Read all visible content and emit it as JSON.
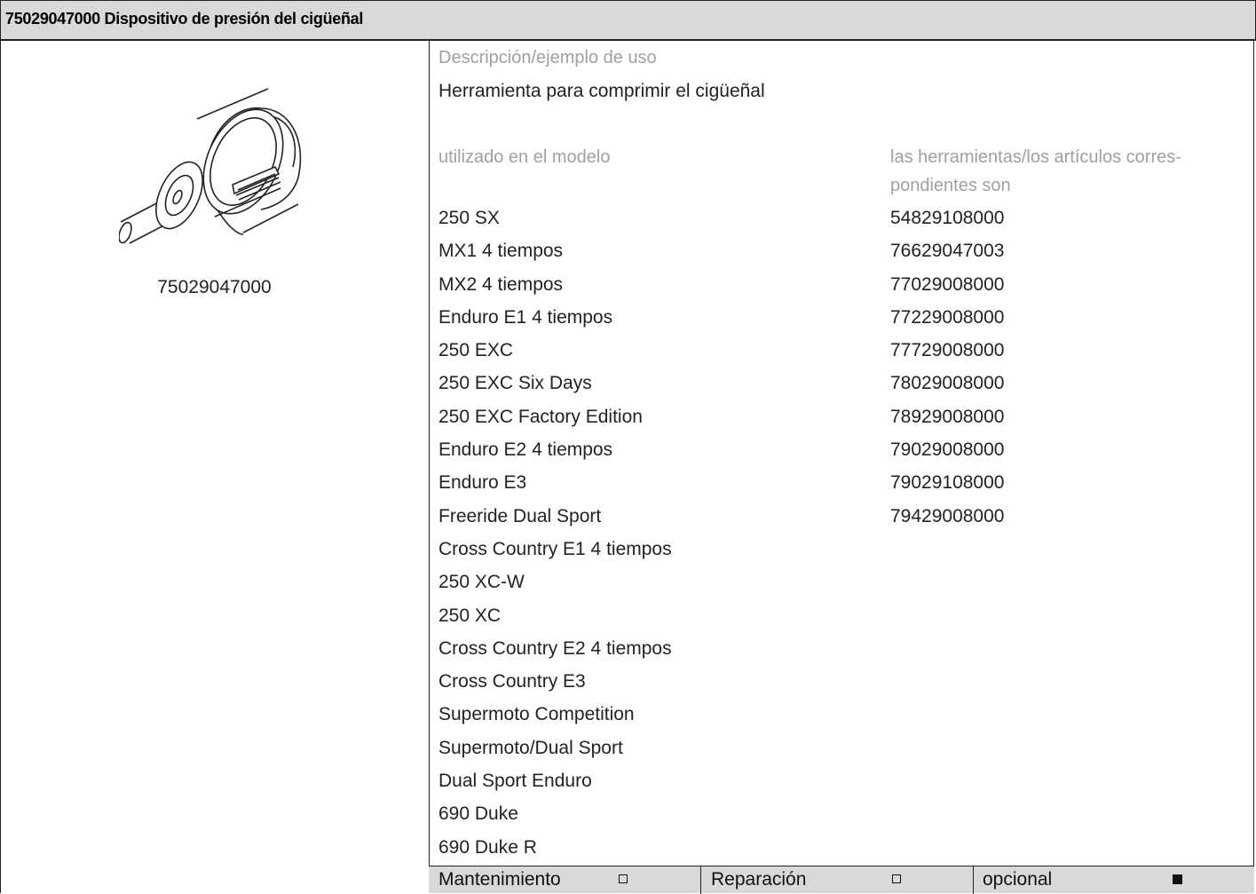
{
  "header": {
    "title": "75029047000 Dispositivo de presión del cigüeñal"
  },
  "image": {
    "caption": "75029047000",
    "icon": "crankshaft-press-tool-illustration"
  },
  "description": {
    "label": "Descripción/ejemplo de uso",
    "text": "Herramienta para comprimir el cigüeñal"
  },
  "models": {
    "label": "utilizado en el modelo",
    "items": [
      "250 SX",
      "MX1 4 tiempos",
      "MX2 4 tiempos",
      "Enduro E1 4 tiempos",
      "250 EXC",
      "250 EXC Six Days",
      "250 EXC Factory Edition",
      "Enduro E2 4 tiempos",
      "Enduro E3",
      "Freeride Dual Sport",
      "Cross Country E1 4 tiempos",
      "250 XC-W",
      "250 XC",
      "Cross Country E2 4 tiempos",
      "Cross Country E3",
      "Supermoto Competition",
      "Supermoto/Dual Sport",
      "Dual Sport Enduro",
      "690 Duke",
      "690 Duke R"
    ]
  },
  "parts": {
    "label_line1": "las herramientas/los artículos corres-",
    "label_line2": "pondientes son",
    "items": [
      "54829108000",
      "76629047003",
      "77029008000",
      "77229008000",
      "77729008000",
      "78029008000",
      "78929008000",
      "79029008000",
      "79029108000",
      "79429008000"
    ]
  },
  "footer": {
    "maintenance": {
      "label": "Mantenimiento",
      "checked": false
    },
    "repair": {
      "label": "Reparación",
      "checked": false
    },
    "optional": {
      "label": "opcional",
      "checked": true
    }
  }
}
